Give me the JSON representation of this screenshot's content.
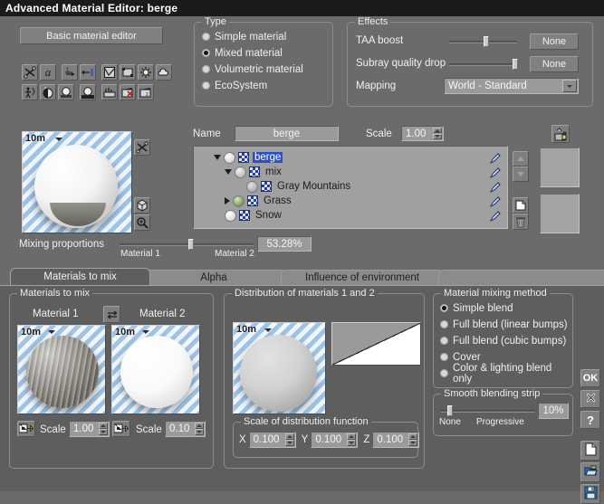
{
  "window": {
    "title": "Advanced Material Editor: berge"
  },
  "toolbar": {
    "basic_editor_label": "Basic material editor",
    "row1_icons": [
      "shuffle-icon",
      "text-a-icon",
      "number-ramp-icon",
      "fit-width-icon",
      "curve-edit-icon",
      "frame-icon",
      "light-bulb-icon",
      "cloud-icon"
    ],
    "row2_icons": [
      "figure-icon",
      "sphere-half-icon",
      "sphere-light-icon",
      "sphere-dark-icon",
      "terrain-icon",
      "clapper-delete-icon",
      "clapper-z-icon"
    ]
  },
  "type_group": {
    "title": "Type",
    "options": [
      {
        "label": "Simple material",
        "selected": false
      },
      {
        "label": "Mixed material",
        "selected": true
      },
      {
        "label": "Volumetric material",
        "selected": false
      },
      {
        "label": "EcoSystem",
        "selected": false
      }
    ]
  },
  "effects_group": {
    "title": "Effects",
    "taa_boost": {
      "label": "TAA boost",
      "value_label": "None",
      "slider_pct": 52
    },
    "subray_quality_drop": {
      "label": "Subray quality drop",
      "value_label": "None",
      "slider_pct": 97
    },
    "mapping": {
      "label": "Mapping",
      "value": "World - Standard"
    }
  },
  "preview": {
    "scale_label": "10m",
    "icons": [
      "shuffle-icon",
      "cube-icon",
      "zoom-icon"
    ]
  },
  "name_row": {
    "name_label": "Name",
    "name_value": "berge",
    "scale_label": "Scale",
    "scale_value": "1.00",
    "lock_icon": "material-lock-icon"
  },
  "tree": {
    "items": [
      {
        "label": "berge",
        "depth": 0,
        "caret": "down",
        "selected": true,
        "ball": "white"
      },
      {
        "label": "mix",
        "depth": 1,
        "caret": "down",
        "selected": false,
        "ball": "white"
      },
      {
        "label": "Gray Mountains",
        "depth": 2,
        "caret": "none",
        "selected": false,
        "ball": "gray"
      },
      {
        "label": "Grass",
        "depth": 2,
        "caret": "right",
        "selected": false,
        "ball": "green"
      },
      {
        "label": "Snow",
        "depth": 1,
        "caret": "none",
        "selected": false,
        "ball": "white"
      }
    ],
    "side_buttons": [
      "move-up-icon",
      "move-down-icon",
      "duplicate-icon",
      "delete-icon"
    ]
  },
  "mixing": {
    "label": "Mixing proportions",
    "material1_label": "Material 1",
    "material2_label": "Material 2",
    "percent": "53.28%",
    "slider_pct": 52
  },
  "tabs": [
    {
      "label": "Materials to mix",
      "active": true
    },
    {
      "label": "Alpha",
      "active": false
    },
    {
      "label": "Influence of environment",
      "active": false
    }
  ],
  "materials_to_mix": {
    "title": "Materials to mix",
    "material1_label": "Material 1",
    "material2_label": "Material 2",
    "swap_icon": "swap-icon",
    "thumb_scale_label": "10m",
    "material1": {
      "scale_label": "Scale",
      "scale_value": "1.00",
      "picker_icon": "texture-picker-icon"
    },
    "material2": {
      "scale_label": "Scale",
      "scale_value": "0.10",
      "picker_icon": "texture-picker-icon"
    }
  },
  "distribution": {
    "title": "Distribution of materials 1 and 2",
    "thumb_scale_label": "10m",
    "scale_group_title": "Scale of distribution function",
    "x": {
      "label": "X",
      "value": "0.100"
    },
    "y": {
      "label": "Y",
      "value": "0.100"
    },
    "z": {
      "label": "Z",
      "value": "0.100"
    }
  },
  "mixing_method": {
    "title": "Material mixing method",
    "options": [
      {
        "label": "Simple blend",
        "selected": true
      },
      {
        "label": "Full blend (linear bumps)",
        "selected": false
      },
      {
        "label": "Full blend (cubic bumps)",
        "selected": false
      },
      {
        "label": "Cover",
        "selected": false
      },
      {
        "label": "Color & lighting blend only",
        "selected": false
      }
    ],
    "smooth_strip": {
      "title": "Smooth blending strip",
      "none_label": "None",
      "progressive_label": "Progressive",
      "value": "10%",
      "slider_pct": 8
    }
  },
  "side_buttons": {
    "ok_label": "OK",
    "cancel_icon": "close-icon",
    "help_icon": "question-icon",
    "new_icon": "new-document-icon",
    "open_icon": "open-folder-icon",
    "save_icon": "save-disk-icon"
  },
  "colors": {
    "window_bg": "#6b6b6b",
    "panel_bg": "#5e5e5e",
    "titlebar_bg": "#1b1b1b",
    "selection_blue": "#2b50c8",
    "field_bg": "#9a9a9a",
    "tree_bg": "#a0a0a0"
  }
}
